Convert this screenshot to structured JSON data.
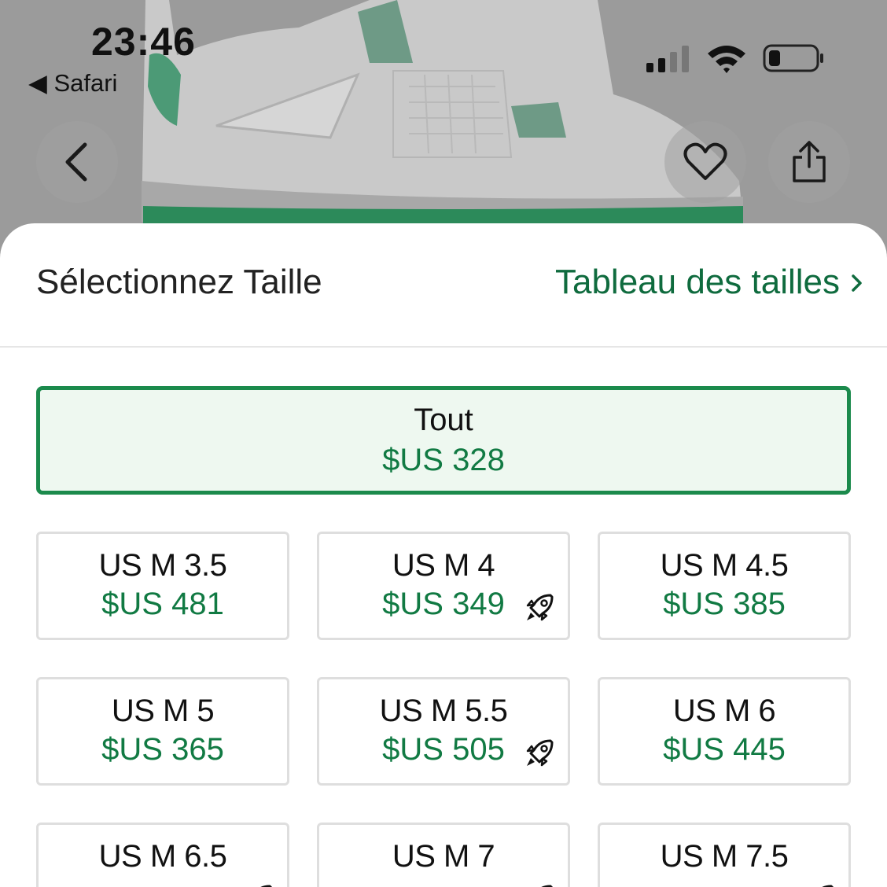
{
  "status_bar": {
    "time": "23:46",
    "back_app": "◀ Safari"
  },
  "header": {
    "title": "Sélectionnez Taille",
    "size_chart_link": "Tableau des tailles"
  },
  "all_option": {
    "label": "Tout",
    "price": "$US 328"
  },
  "sizes": [
    {
      "label": "US M 3.5",
      "price": "$US 481",
      "express": false
    },
    {
      "label": "US M 4",
      "price": "$US 349",
      "express": true
    },
    {
      "label": "US M 4.5",
      "price": "$US 385",
      "express": false
    },
    {
      "label": "US M 5",
      "price": "$US 365",
      "express": false
    },
    {
      "label": "US M 5.5",
      "price": "$US 505",
      "express": true
    },
    {
      "label": "US M 6",
      "price": "$US 445",
      "express": false
    },
    {
      "label": "US M 6.5",
      "price": "",
      "express": true
    },
    {
      "label": "US M 7",
      "price": "",
      "express": true
    },
    {
      "label": "US M 7.5",
      "price": "",
      "express": true
    }
  ],
  "colors": {
    "accent": "#117a43",
    "selected_bg": "#eef8f0",
    "selected_border": "#1b8a4c"
  },
  "icons": [
    "back-chevron-icon",
    "heart-icon",
    "share-icon",
    "rocket-icon",
    "chevron-right-icon",
    "signal-icon",
    "wifi-icon",
    "battery-icon"
  ]
}
